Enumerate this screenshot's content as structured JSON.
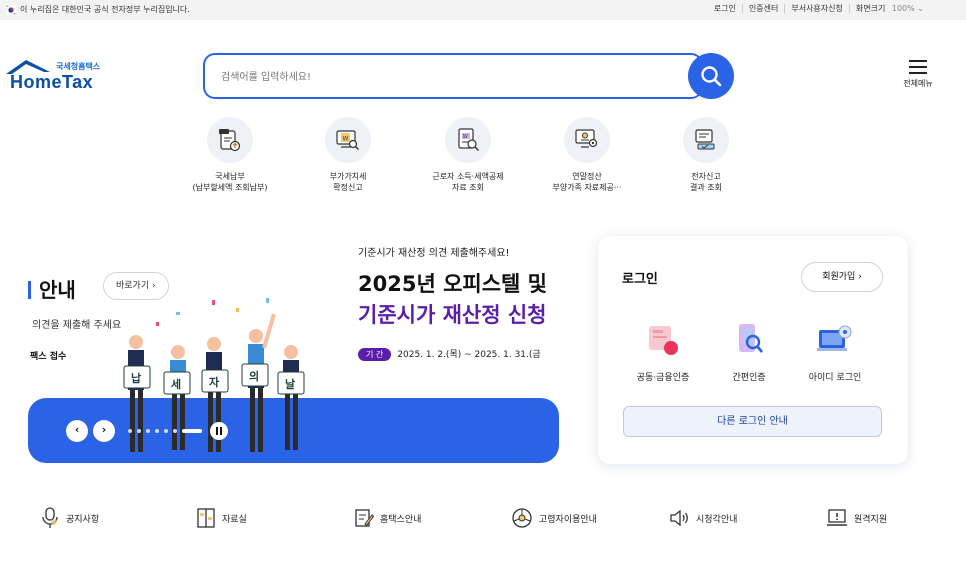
{
  "gov_bar": {
    "notice": "이 누리집은 대한민국 공식 전자정부 누리집입니다.",
    "links": [
      "로그인",
      "인증센터",
      "부서사용자신청"
    ],
    "zoom_label": "화면크기",
    "zoom_value": "100%"
  },
  "header": {
    "logo_sub": "국세청홈택스",
    "logo_main": "HomeTax",
    "search_placeholder": "검색어를 입력하세요!",
    "menu_label": "전체메뉴"
  },
  "quick_menu": [
    {
      "label": "국세납부\n(납부할세액 조회납부)",
      "icon": "tax-payment-icon"
    },
    {
      "label": "부가가치세\n확정신고",
      "icon": "vat-report-icon"
    },
    {
      "label": "근로자 소득·세액공제\n자료 조회",
      "icon": "deduction-search-icon"
    },
    {
      "label": "연말정산\n부양가족 자료제공···",
      "icon": "year-end-icon"
    },
    {
      "label": "전자신고\n결과 조회",
      "icon": "e-filing-result-icon"
    }
  ],
  "banner": {
    "left_title": "안내",
    "goto_label": "바로가기",
    "left_desc": "의견을 제출해 주세요",
    "left_sub": "팩스 접수",
    "right_small": "기준시가 재산정 의견 제출해주세요!",
    "right_big1": "2025년 오피스텔 및",
    "right_big2": "기준시가 재산정 신청",
    "period_tag": "기 간",
    "period_text": "2025. 1. 2.(목) ~ 2025. 1. 31.(금",
    "sign_chars": [
      "납",
      "세",
      "자",
      "의",
      "날"
    ]
  },
  "login": {
    "title": "로그인",
    "join_label": "회원가입",
    "options": [
      {
        "label": "공동·금융인증",
        "icon": "certificate-icon"
      },
      {
        "label": "간편인증",
        "icon": "simple-auth-icon"
      },
      {
        "label": "아이디 로그인",
        "icon": "id-login-icon"
      }
    ],
    "other_label": "다른 로그인 안내"
  },
  "bottom_links": [
    {
      "label": "공지사항",
      "icon": "microphone-icon"
    },
    {
      "label": "자료실",
      "icon": "archive-icon"
    },
    {
      "label": "홈택스안내",
      "icon": "guide-icon"
    },
    {
      "label": "고령자이용안내",
      "icon": "senior-icon"
    },
    {
      "label": "시청각안내",
      "icon": "audio-visual-icon"
    },
    {
      "label": "원격지원",
      "icon": "remote-support-icon"
    }
  ],
  "colors": {
    "primary": "#2a63e6",
    "banner_accent": "#5a1ea8",
    "logo": "#0b4fa8"
  }
}
